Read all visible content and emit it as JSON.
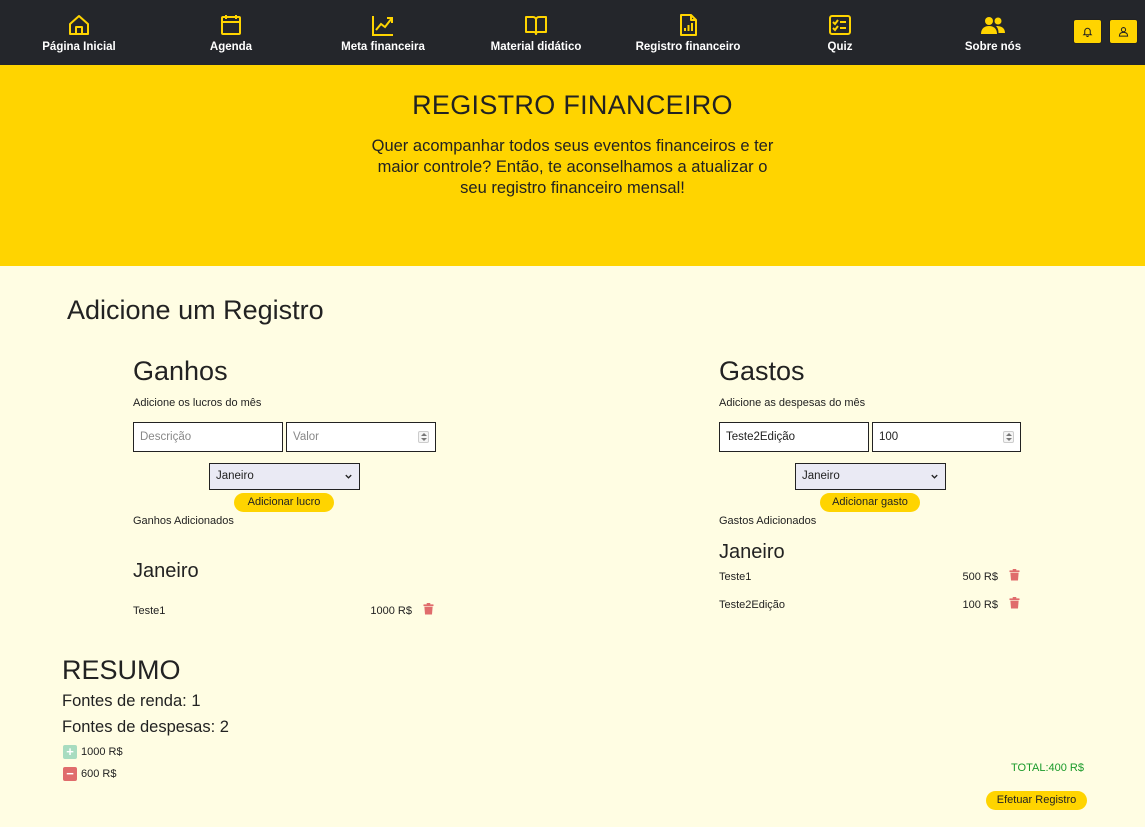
{
  "nav": {
    "items": [
      {
        "label": "Página Inicial",
        "icon": "home-icon"
      },
      {
        "label": "Agenda",
        "icon": "calendar-icon"
      },
      {
        "label": "Meta financeira",
        "icon": "chart-line-icon"
      },
      {
        "label": "Material didático",
        "icon": "book-icon"
      },
      {
        "label": "Registro financeiro",
        "icon": "report-icon"
      },
      {
        "label": "Quiz",
        "icon": "checklist-icon"
      },
      {
        "label": "Sobre nós",
        "icon": "people-icon"
      }
    ],
    "bell_icon": "bell-icon",
    "user_icon": "user-icon"
  },
  "hero": {
    "title": "REGISTRO FINANCEIRO",
    "subtitle": "Quer acompanhar todos seus eventos financeiros e ter maior controle? Então, te aconselhamos a atualizar o seu registro financeiro mensal!"
  },
  "main": {
    "heading": "Adicione um Registro"
  },
  "ganhos": {
    "title": "Ganhos",
    "subtitle": "Adicione os lucros do mês",
    "desc_placeholder": "Descrição",
    "valor_placeholder": "Valor",
    "month_select": "Janeiro",
    "button": "Adicionar lucro",
    "list_label": "Ganhos Adicionados",
    "month": "Janeiro",
    "rows": [
      {
        "desc": "Teste1",
        "value": "1000 R$"
      }
    ]
  },
  "gastos": {
    "title": "Gastos",
    "subtitle": "Adicione as despesas do mês",
    "desc_value": "Teste2Edição",
    "valor_value": "100",
    "month_select": "Janeiro",
    "button": "Adicionar gasto",
    "list_label": "Gastos Adicionados",
    "month": "Janeiro",
    "rows": [
      {
        "desc": "Teste1",
        "value": "500 R$"
      },
      {
        "desc": "Teste2Edição",
        "value": "100 R$"
      }
    ]
  },
  "resumo": {
    "title": "RESUMO",
    "renda": "Fontes de renda: 1",
    "despesas": "Fontes de despesas: 2",
    "plus": "+",
    "minus": "−",
    "income_total": "1000 R$",
    "expense_total": "600 R$",
    "total": "TOTAL:400 R$",
    "submit": "Efetuar Registro"
  },
  "colors": {
    "accent": "#ffd400",
    "nav_bg": "#24262b",
    "page_bg": "#fffde3",
    "positive": "#a8dcc0",
    "negative": "#e06c6c",
    "total": "#1a9a2a"
  }
}
